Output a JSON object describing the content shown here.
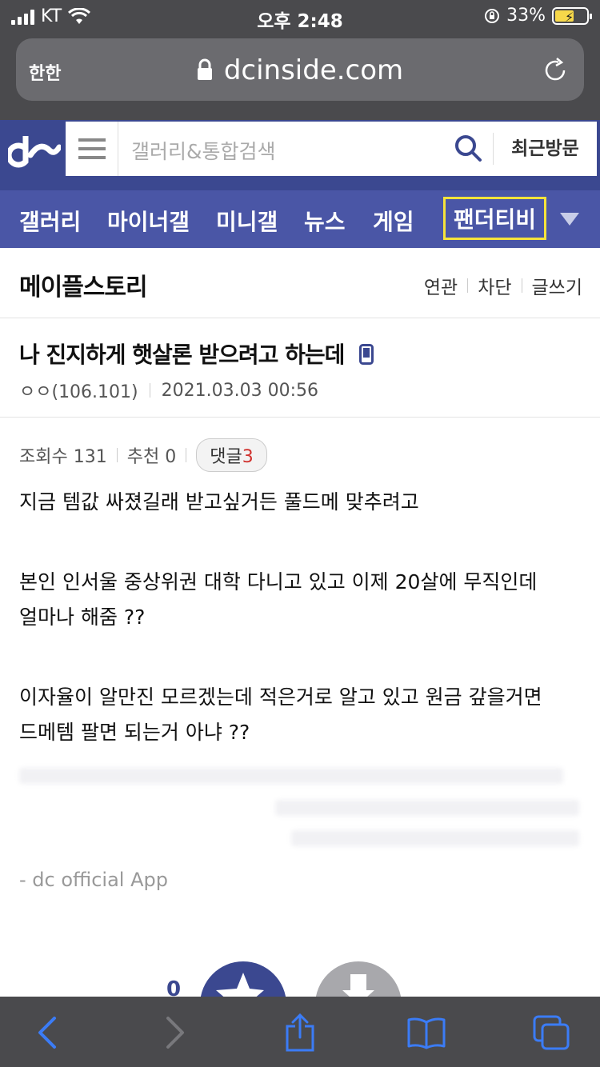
{
  "status_bar": {
    "carrier": "KT",
    "time": "오후 2:48",
    "battery_percent": "33%"
  },
  "url_bar": {
    "aa_label": "한한",
    "domain": "dcinside.com"
  },
  "header": {
    "search_placeholder": "갤러리&통합검색",
    "recent_label": "최근방문"
  },
  "nav": {
    "items": [
      "갤러리",
      "마이너갤",
      "미니갤",
      "뉴스",
      "게임",
      "팬더티비"
    ]
  },
  "gallery": {
    "title": "메이플스토리",
    "actions": [
      "연관",
      "차단",
      "글쓰기"
    ]
  },
  "post": {
    "title": "나 진지하게 햇살론 받으려고 하는데",
    "author": "ㅇㅇ(106.101)",
    "date": "2021.03.03 00:56",
    "views": "조회수 131",
    "recommend": "추천 0",
    "comment_label": "댓글",
    "comment_count": "3",
    "body": [
      "지금 템값 싸졌길래 받고싶거든 풀드메 맞추려고",
      "본인 인서울 중상위권 대학 다니고 있고 이제 20살에 무직인데",
      "얼마나 해줌 ??",
      "이자율이 알만진 모르겠는데 적은거로 알고 있고 원금 갚을거면",
      "드메템 팔면 되는거 아냐 ??"
    ],
    "signature": "- dc official App",
    "vote_count": "0"
  },
  "colors": {
    "brand": "#3b4890",
    "nav": "#4a56a6",
    "highlight": "#f5e33b",
    "comment_count": "#d0312d",
    "toolbar_icon": "#3b7cf6"
  }
}
